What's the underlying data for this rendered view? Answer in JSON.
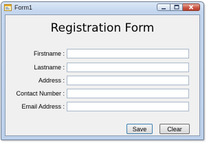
{
  "window": {
    "title": "Form1",
    "controls": {
      "minimize": "minimize",
      "maximize": "maximize",
      "close": "close"
    }
  },
  "form": {
    "heading": "Registration Form",
    "fields": [
      {
        "label": "Firstname :",
        "value": ""
      },
      {
        "label": "Lastname :",
        "value": ""
      },
      {
        "label": "Address :",
        "value": ""
      },
      {
        "label": "Contact Number :",
        "value": ""
      },
      {
        "label": "Email Address :",
        "value": ""
      }
    ],
    "buttons": {
      "save": "Save",
      "clear": "Clear"
    }
  }
}
